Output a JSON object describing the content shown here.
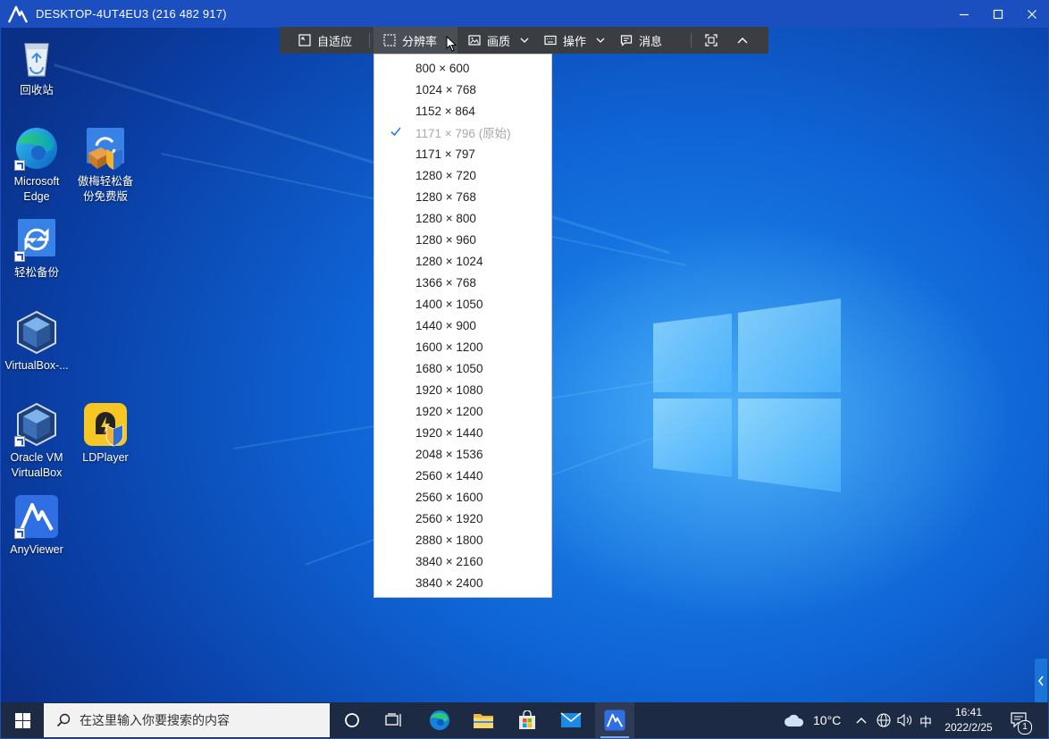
{
  "window": {
    "title": "DESKTOP-4UT4EU3 (216 482 917)",
    "controls": [
      "minimize-icon",
      "maximize-icon",
      "close-icon"
    ]
  },
  "toolbar": {
    "fit_label": "自适应",
    "resolution_label": "分辨率",
    "quality_label": "画质",
    "operation_label": "操作",
    "message_label": "消息"
  },
  "resolution_menu": {
    "items": [
      {
        "label": "800 × 600"
      },
      {
        "label": "1024 × 768"
      },
      {
        "label": "1152 × 864"
      },
      {
        "label": "1171 × 796 (原始)",
        "selected": true,
        "disabled": true
      },
      {
        "label": "1171 × 797"
      },
      {
        "label": "1280 × 720"
      },
      {
        "label": "1280 × 768"
      },
      {
        "label": "1280 × 800"
      },
      {
        "label": "1280 × 960"
      },
      {
        "label": "1280 × 1024"
      },
      {
        "label": "1366 × 768"
      },
      {
        "label": "1400 × 1050"
      },
      {
        "label": "1440 × 900"
      },
      {
        "label": "1600 × 1200"
      },
      {
        "label": "1680 × 1050"
      },
      {
        "label": "1920 × 1080"
      },
      {
        "label": "1920 × 1200"
      },
      {
        "label": "1920 × 1440"
      },
      {
        "label": "2048 × 1536"
      },
      {
        "label": "2560 × 1440"
      },
      {
        "label": "2560 × 1600"
      },
      {
        "label": "2560 × 1920"
      },
      {
        "label": "2880 × 1800"
      },
      {
        "label": "3840 × 2160"
      },
      {
        "label": "3840 × 2400"
      }
    ]
  },
  "desktop_icons": {
    "recycle_bin": "回收站",
    "edge": "Microsoft Edge",
    "aomei_free": "傲梅轻松备份免费版",
    "backup": "轻松备份",
    "virtualbox_dots": "VirtualBox-...",
    "oracle_vm": "Oracle VM VirtualBox",
    "ldplayer": "LDPlayer",
    "anyviewer": "AnyViewer"
  },
  "taskbar": {
    "search_placeholder": "在这里输入你要搜索的内容",
    "weather_temp": "10°C",
    "ime": "中",
    "time": "16:41",
    "date": "2022/2/25",
    "notification_count": "1"
  },
  "colors": {
    "titlebar": "#1b4fbf",
    "toolbar": "#3a3d42",
    "taskbar": "#1d2a44",
    "accent": "#2b7de9"
  }
}
